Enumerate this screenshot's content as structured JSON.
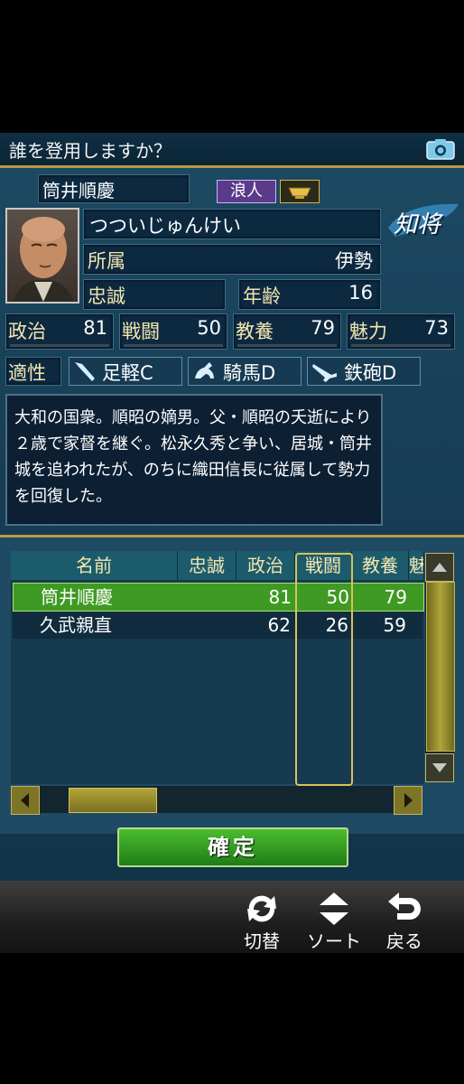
{
  "header": {
    "title": "誰を登用しますか？"
  },
  "officer": {
    "name": "筒井順慶",
    "status_badge": "浪人",
    "reading": "つついじゅんけい",
    "affiliation_label": "所属",
    "affiliation_value": "伊勢",
    "loyalty_label": "忠誠",
    "loyalty_value": "",
    "age_label": "年齢",
    "age_value": "16",
    "type_badge": "知将",
    "stats": [
      {
        "label": "政治",
        "value": "81",
        "level": 0.81
      },
      {
        "label": "戦闘",
        "value": "50",
        "level": 0.5
      },
      {
        "label": "教養",
        "value": "79",
        "level": 0.79
      },
      {
        "label": "魅力",
        "value": "73",
        "level": 0.73
      }
    ],
    "aptitude_label": "適性",
    "aptitudes": [
      "足軽C",
      "騎馬D",
      "鉄砲D"
    ],
    "description": "大和の国衆。順昭の嫡男。父・順昭の夭逝により２歳で家督を継ぐ。松永久秀と争い、居城・筒井城を追われたが、のちに織田信長に従属して勢力を回復した。"
  },
  "table": {
    "columns": [
      "名前",
      "忠誠",
      "政治",
      "戦闘",
      "教養",
      "魅"
    ],
    "rows": [
      {
        "name": "筒井順慶",
        "loyalty": "",
        "politics": "81",
        "combat": "50",
        "culture": "79",
        "selected": true
      },
      {
        "name": "久武親直",
        "loyalty": "",
        "politics": "62",
        "combat": "26",
        "culture": "59",
        "selected": false
      }
    ]
  },
  "confirm_label": "確定",
  "bottom": {
    "switch": "切替",
    "sort": "ソート",
    "back": "戻る"
  },
  "colors": {
    "accent_gold": "#b99a45",
    "selected_row": "#3f9a24",
    "confirm": "#3aa625"
  }
}
